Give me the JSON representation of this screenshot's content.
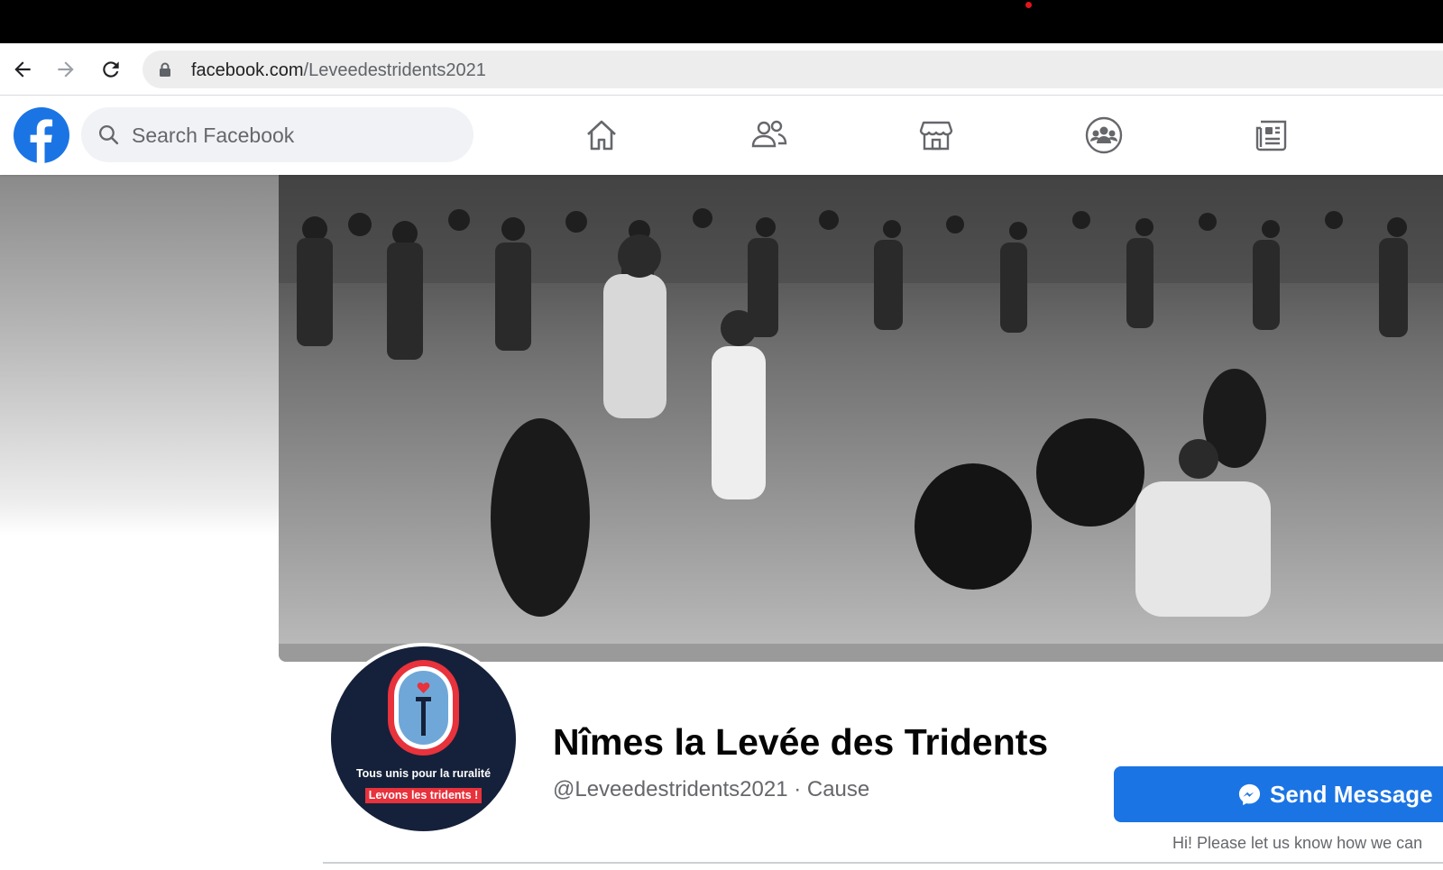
{
  "browser": {
    "url_domain": "facebook.com",
    "url_path": "/Leveedestridents2021",
    "back_icon": "arrow-left-icon",
    "forward_icon": "arrow-right-icon",
    "reload_icon": "reload-icon",
    "lock_icon": "lock-icon"
  },
  "facebook": {
    "logo_icon": "facebook-logo-icon",
    "search_placeholder": "Search Facebook",
    "nav_icons": [
      "home-icon",
      "friends-icon",
      "marketplace-icon",
      "groups-icon",
      "news-icon"
    ],
    "brand_color": "#1b74e4"
  },
  "page": {
    "name": "Nîmes la Levée des Tridents",
    "handle": "@Leveedestridents2021 · Cause",
    "avatar_tagline": "Tous unis pour la ruralité",
    "avatar_tagline2": "Levons les tridents !",
    "send_button_label": "Send Message",
    "message_hint": "Hi! Please let us know how we can"
  }
}
